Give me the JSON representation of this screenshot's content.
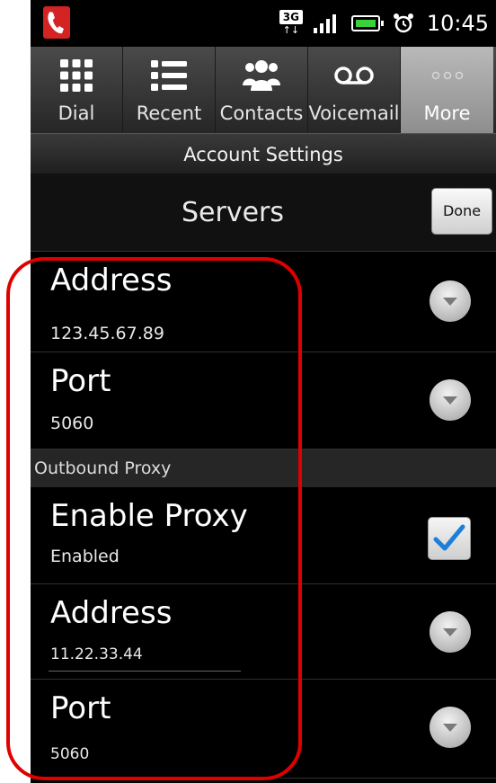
{
  "status_bar": {
    "network": "3G",
    "time": "10:45"
  },
  "tabs": [
    {
      "label": "Dial",
      "icon": "dialpad-icon",
      "active": false
    },
    {
      "label": "Recent",
      "icon": "list-icon",
      "active": false
    },
    {
      "label": "Contacts",
      "icon": "contacts-icon",
      "active": false
    },
    {
      "label": "Voicemail",
      "icon": "voicemail-icon",
      "active": false
    },
    {
      "label": "More",
      "icon": "more-icon",
      "active": true
    }
  ],
  "header": {
    "title": "Account Settings"
  },
  "servers": {
    "title": "Servers",
    "done_label": "Done"
  },
  "server": {
    "address": {
      "label": "Address",
      "value": "123.45.67.89"
    },
    "port": {
      "label": "Port",
      "value": "5060"
    }
  },
  "proxy_section": {
    "title": "Outbound Proxy"
  },
  "proxy": {
    "enable": {
      "label": "Enable Proxy",
      "value": "Enabled",
      "checked": true
    },
    "address": {
      "label": "Address",
      "value": "11.22.33.44"
    },
    "port": {
      "label": "Port",
      "value": "5060"
    }
  },
  "colors": {
    "highlight": "#e00000",
    "check": "#1e7fd8",
    "app_icon": "#d32323"
  }
}
